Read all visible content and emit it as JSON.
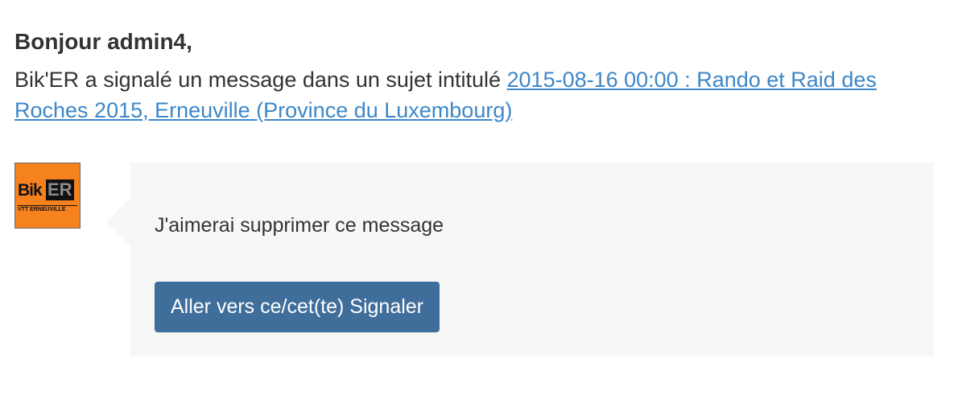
{
  "greeting": "Bonjour admin4,",
  "intro": {
    "text": "Bik'ER a signalé un message dans un sujet intitulé ",
    "topic_link": "2015-08-16 00:00 : Rando et Raid des Roches 2015, Erneuville (Province du Luxembourg)"
  },
  "avatar": {
    "logo_text_bik": "Bik",
    "logo_text_er": "ER",
    "logo_subtitle": "VTT ERNEUVILLE"
  },
  "post": {
    "message": "J'aimerai supprimer ce message",
    "button_label": "Aller vers ce/cet(te) Signaler"
  },
  "colors": {
    "link": "#3d87c9",
    "button": "#3f6e9b",
    "bubble": "#f7f7f7",
    "avatar_bg": "#f5821f"
  }
}
